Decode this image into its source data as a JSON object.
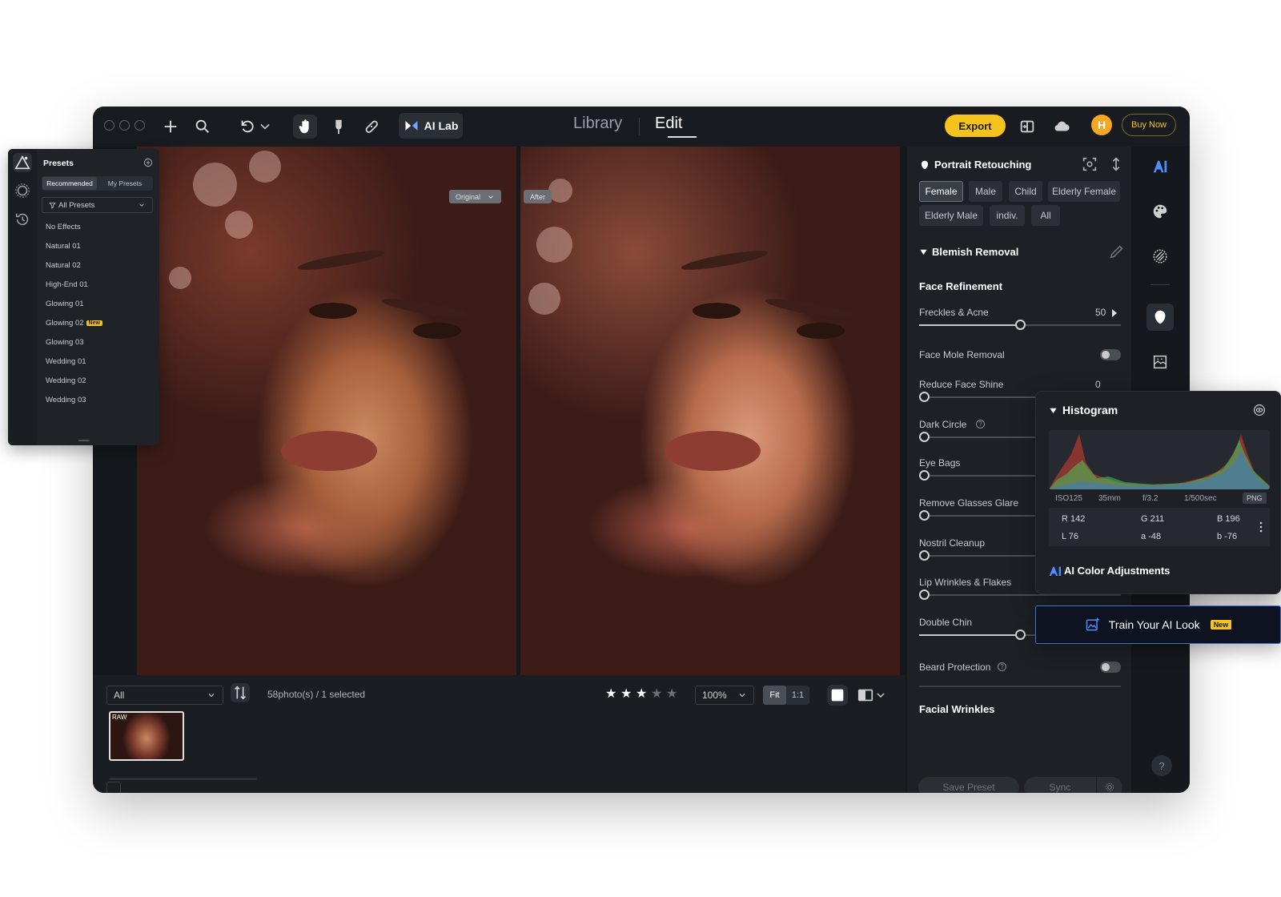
{
  "topbar": {
    "ai_lab_label": "AI Lab",
    "tabs": [
      "Library",
      "Edit"
    ],
    "active_tab": "Edit",
    "export_label": "Export",
    "avatar_initial": "H",
    "buy_label": "Buy Now"
  },
  "viewer": {
    "before_tag": "Original",
    "after_tag": "After"
  },
  "bottombar": {
    "filter_value": "All",
    "photo_count": "58photo(s) / 1 selected",
    "rating": 3,
    "rating_max": 5,
    "zoom_value": "100%",
    "fit_label": "Fit",
    "one_to_one_label": "1:1",
    "thumb_tag": "RAW"
  },
  "portrait": {
    "title": "Portrait Retouching",
    "chips": [
      "Female",
      "Male",
      "Child",
      "Elderly Female",
      "Elderly Male",
      "indiv.",
      "All"
    ],
    "active_chip": "Female",
    "blemish_title": "Blemish Removal",
    "face_refinement_title": "Face Refinement",
    "sliders": [
      {
        "label": "Freckles & Acne",
        "value": "50",
        "level": 0.5
      },
      {
        "label": "Reduce Face Shine",
        "value": "0",
        "level": 0
      },
      {
        "label": "Dark Circle",
        "level": 0
      },
      {
        "label": "Eye Bags",
        "level": 0
      },
      {
        "label": "Remove Glasses Glare",
        "level": 0
      },
      {
        "label": "Nostril Cleanup",
        "level": 0
      },
      {
        "label": "Lip Wrinkles & Flakes",
        "level": 0
      },
      {
        "label": "Double Chin",
        "level": 0.5
      }
    ],
    "toggles": [
      {
        "label": "Face Mole Removal",
        "on": false
      },
      {
        "label": "Beard Protection",
        "on": false
      }
    ],
    "facial_wrinkles_title": "Facial Wrinkles",
    "save_preset_label": "Save Preset",
    "sync_label": "Sync"
  },
  "presets": {
    "title": "Presets",
    "tabs": [
      "Recommended",
      "My Presets"
    ],
    "active_tab": "Recommended",
    "filter_value": "All Presets",
    "items": [
      "No Effects",
      "Natural 01",
      "Natural 02",
      "High-End 01",
      "Glowing 01",
      "Glowing 02",
      "Glowing 03",
      "Wedding 01",
      "Wedding 02",
      "Wedding 03"
    ],
    "new_badge_item": "Glowing 02",
    "new_badge_label": "New"
  },
  "histogram": {
    "title": "Histogram",
    "iso": "ISO125",
    "focal": "35mm",
    "aperture": "f/3.2",
    "shutter": "1/500sec",
    "format": "PNG",
    "r": "R 142",
    "g": "G 211",
    "b": "B 196",
    "l": "L 76",
    "a": "a -48",
    "lab_b": "b -76",
    "ai_color_title": "AI Color Adjustments"
  },
  "train_ai": {
    "label": "Train Your AI Look",
    "badge": "New"
  },
  "colors": {
    "accent_yellow": "#f6c31c",
    "avatar_orange": "#f5a623",
    "train_border": "#3b6fd6"
  }
}
